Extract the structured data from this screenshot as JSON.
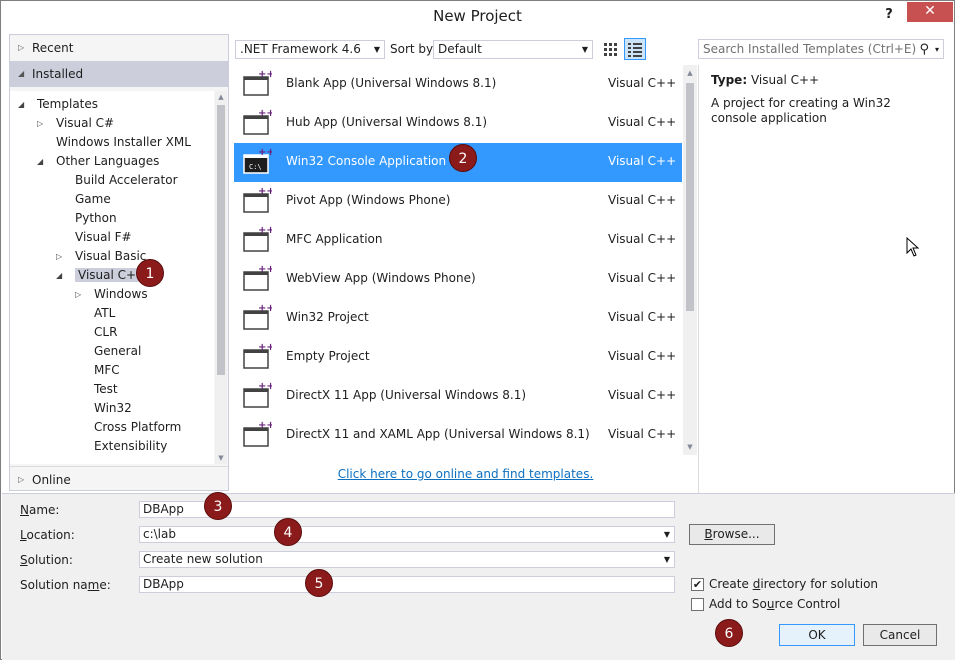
{
  "window": {
    "title": "New Project",
    "help": "?",
    "close": "✕"
  },
  "nav": {
    "recent": "Recent",
    "installed": "Installed",
    "online": "Online",
    "tree": [
      {
        "label": "Templates",
        "depth": 0,
        "arrow": "◢"
      },
      {
        "label": "Visual C#",
        "depth": 1,
        "arrow": "▷"
      },
      {
        "label": "Windows Installer XML",
        "depth": 1,
        "arrow": ""
      },
      {
        "label": "Other Languages",
        "depth": 1,
        "arrow": "◢"
      },
      {
        "label": "Build Accelerator",
        "depth": 2,
        "arrow": ""
      },
      {
        "label": "Game",
        "depth": 2,
        "arrow": ""
      },
      {
        "label": "Python",
        "depth": 2,
        "arrow": ""
      },
      {
        "label": "Visual F#",
        "depth": 2,
        "arrow": ""
      },
      {
        "label": "Visual Basic",
        "depth": 2,
        "arrow": "▷"
      },
      {
        "label": "Visual C++",
        "depth": 2,
        "arrow": "◢",
        "selected": true
      },
      {
        "label": "Windows",
        "depth": 3,
        "arrow": "▷"
      },
      {
        "label": "ATL",
        "depth": 3,
        "arrow": ""
      },
      {
        "label": "CLR",
        "depth": 3,
        "arrow": ""
      },
      {
        "label": "General",
        "depth": 3,
        "arrow": ""
      },
      {
        "label": "MFC",
        "depth": 3,
        "arrow": ""
      },
      {
        "label": "Test",
        "depth": 3,
        "arrow": ""
      },
      {
        "label": "Win32",
        "depth": 3,
        "arrow": ""
      },
      {
        "label": "Cross Platform",
        "depth": 3,
        "arrow": ""
      },
      {
        "label": "Extensibility",
        "depth": 3,
        "arrow": ""
      }
    ]
  },
  "toolbar": {
    "framework": ".NET Framework 4.6",
    "sort_label": "Sort by:",
    "sort_value": "Default",
    "search_placeholder": "Search Installed Templates (Ctrl+E)"
  },
  "templates": [
    {
      "name": "Blank App (Universal Windows 8.1)",
      "lang": "Visual C++",
      "icon": "blank-app-icon"
    },
    {
      "name": "Hub App (Universal Windows 8.1)",
      "lang": "Visual C++",
      "icon": "hub-app-icon"
    },
    {
      "name": "Win32 Console Application",
      "lang": "Visual C++",
      "icon": "console-app-icon",
      "selected": true
    },
    {
      "name": "Pivot App (Windows Phone)",
      "lang": "Visual C++",
      "icon": "pivot-app-icon"
    },
    {
      "name": "MFC Application",
      "lang": "Visual C++",
      "icon": "mfc-app-icon"
    },
    {
      "name": "WebView App (Windows Phone)",
      "lang": "Visual C++",
      "icon": "webview-app-icon"
    },
    {
      "name": "Win32 Project",
      "lang": "Visual C++",
      "icon": "win32-project-icon"
    },
    {
      "name": "Empty Project",
      "lang": "Visual C++",
      "icon": "empty-project-icon"
    },
    {
      "name": "DirectX 11 App (Universal Windows 8.1)",
      "lang": "Visual C++",
      "icon": "directx-app-icon"
    },
    {
      "name": "DirectX 11 and XAML App (Universal Windows 8.1)",
      "lang": "Visual C++",
      "icon": "directx-xaml-app-icon"
    }
  ],
  "online_link": "Click here to go online and find templates.",
  "info": {
    "type_label": "Type:",
    "type_value": "Visual C++",
    "description": "A project for creating a Win32 console application"
  },
  "form": {
    "name_label": "Name:",
    "name_value": "DBApp",
    "location_label": "Location:",
    "location_value": "c:\\lab",
    "solution_label": "Solution:",
    "solution_value": "Create new solution",
    "solution_name_label": "Solution name:",
    "solution_name_value": "DBApp",
    "browse": "Browse...",
    "create_dir_label": "Create directory for solution",
    "create_dir_checked": true,
    "source_control_label": "Add to Source Control",
    "source_control_checked": false,
    "ok": "OK",
    "cancel": "Cancel"
  },
  "callouts": [
    "1",
    "2",
    "3",
    "4",
    "5",
    "6"
  ],
  "colors": {
    "accent": "#3399ff",
    "callout": "#8b1a1a",
    "close": "#c75050",
    "link": "#0e70c0"
  }
}
